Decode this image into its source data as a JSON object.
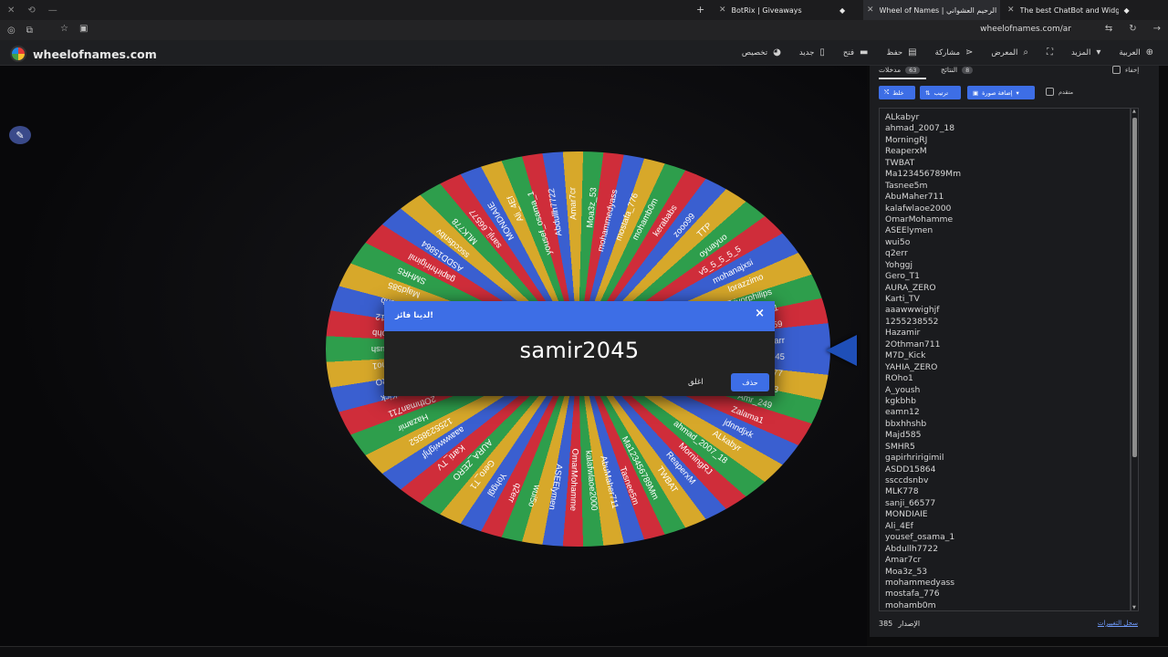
{
  "browser": {
    "tabs": [
      {
        "title": "BotRix | Giveaways"
      },
      {
        "title": "Wheel of Names | عبدالرحيم العشواني"
      },
      {
        "title": "The best ChatBot and Widgets"
      }
    ],
    "url": "wheelofnames.com/ar"
  },
  "site": {
    "logo_text": "wheelofnames.com",
    "nav": [
      {
        "label": "تخصيص",
        "icon": "palette-icon"
      },
      {
        "label": "جديد",
        "icon": "new-file-icon"
      },
      {
        "label": "فتح",
        "icon": "folder-icon"
      },
      {
        "label": "حفظ",
        "icon": "save-icon"
      },
      {
        "label": "مشاركة",
        "icon": "share-icon"
      },
      {
        "label": "المعرض",
        "icon": "search-icon"
      },
      {
        "label": "",
        "icon": "fullscreen-icon"
      },
      {
        "label": "المزيد",
        "icon": "chevron-down-icon"
      },
      {
        "label": "العربية",
        "icon": "globe-icon"
      }
    ]
  },
  "wheel": {
    "colors": [
      "#3a5fd0",
      "#d7a82a",
      "#2e9e4c",
      "#cf2d3a"
    ],
    "visible_labels": [
      "samir2045",
      "usefzx777",
      "Majd503",
      "Amr_249",
      "Zalama1",
      "jdnndjxk",
      "ALkabyr",
      "ahmad_2007_18",
      "MorningRJ",
      "ReaperxM",
      "TWBAT",
      "Ma123456789Mm",
      "Tasnee5m",
      "AbuMaher711",
      "kalafwlaoe2000",
      "OmarMohamme",
      "ASEElymen",
      "wui5o",
      "q2err",
      "Yohggj",
      "Gero_T1",
      "AURA_ZERO",
      "Karti_TV",
      "aaawwwighjf",
      "1255238552",
      "Hazamir",
      "2Othman711",
      "M7D_Kick",
      "YAHIA_ZERO",
      "ROho1",
      "A_yoush",
      "kgkbhb",
      "eamn12",
      "bbxhhshb",
      "Majd585",
      "SMHR5",
      "gapirhririgimil",
      "ASDD15864",
      "ssccdsnbv",
      "MLK778",
      "sanji_66577",
      "MONDIAIE",
      "Ali_4Ef",
      "yousef_osama_1",
      "Abdullh7722",
      "Amar7cr",
      "Moa3z_53",
      "mohammedyass",
      "mostafa_776",
      "mohamb0m",
      "kerababs",
      "zooo99",
      "TTP",
      "oyuayuo",
      "v5_5_5_5_5",
      "mohanajxsi",
      "lorazzimo",
      "Trivorphilips",
      "esmailx1",
      "stafa459",
      "mad_arr"
    ]
  },
  "dialog": {
    "title": "لدينا فائز!",
    "winner": "samir2045",
    "close_label": "اغلق",
    "remove_label": "حذف"
  },
  "panel": {
    "tab_entries_label": "مدخلات",
    "tab_entries_count": "63",
    "tab_results_label": "النتائج",
    "tab_results_count": "8",
    "hide_label": "إخفاء",
    "shuffle_label": "خلط",
    "sort_label": "ترتيب",
    "add_image_label": "إضافة صورة",
    "advanced_label": "متقدم",
    "entries": [
      "ALkabyr",
      "ahmad_2007_18",
      "MorningRJ",
      "ReaperxM",
      "TWBAT",
      "Ma123456789Mm",
      "Tasnee5m",
      "AbuMaher711",
      "kalafwlaoe2000",
      "OmarMohamme",
      "ASEElymen",
      "wui5o",
      "q2err",
      "Yohggj",
      "Gero_T1",
      "AURA_ZERO",
      "Karti_TV",
      "aaawwwighjf",
      "1255238552",
      "Hazamir",
      "2Othman711",
      "M7D_Kick",
      "YAHIA_ZERO",
      "ROho1",
      "A_yoush",
      "kgkbhb",
      "eamn12",
      "bbxhhshb",
      "Majd585",
      "SMHR5",
      "gapirhririgimil",
      "ASDD15864",
      "ssccdsnbv",
      "MLK778",
      "sanji_66577",
      "MONDIAIE",
      "Ali_4Ef",
      "yousef_osama_1",
      "Abdullh7722",
      "Amar7cr",
      "Moa3z_53",
      "mohammedyass",
      "mostafa_776",
      "mohamb0m"
    ],
    "version_label": "الإصدار",
    "version": "385",
    "changelog_label": "سجل التغييرات"
  }
}
